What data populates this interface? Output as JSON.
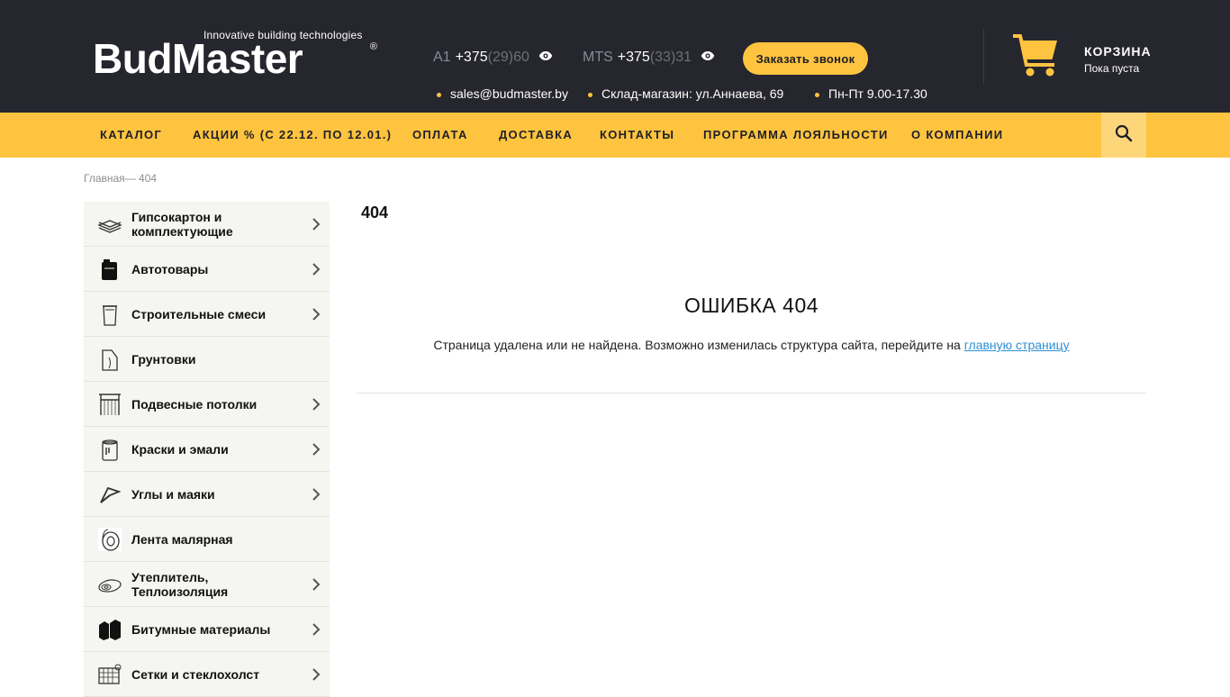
{
  "header": {
    "logo_tagline": "Innovative building technologies",
    "logo_text": "BudMaster",
    "logo_reg": "®",
    "phones": [
      {
        "operator": "A1",
        "main": "+375",
        "hidden": "(29)60"
      },
      {
        "operator": "MTS",
        "main": "+375",
        "hidden": "(33)31"
      }
    ],
    "callback_label": "Заказать звонок",
    "email": "sales@budmaster.by",
    "address": "Склад-магазин: ул.Аннаева, 69",
    "hours": "Пн-Пт 9.00-17.30",
    "cart_title": "КОРЗИНА",
    "cart_status": "Пока пуста"
  },
  "nav": {
    "items": [
      {
        "label": "КАТАЛОГ"
      },
      {
        "label": "АКЦИИ % (С 22.12. ПО 12.01.)"
      },
      {
        "label": "ОПЛАТА"
      },
      {
        "label": "ДОСТАВКА"
      },
      {
        "label": "КОНТАКТЫ"
      },
      {
        "label": "ПРОГРАММА ЛОЯЛЬНОСТИ"
      },
      {
        "label": "О КОМПАНИИ"
      }
    ],
    "search_icon": "search-icon"
  },
  "breadcrumb": {
    "home": "Главная",
    "separator": "— ",
    "current": "404"
  },
  "sidebar": {
    "categories": [
      {
        "label": "Гипсокартон и комплектующие",
        "icon": "drywall-icon",
        "has_children": true
      },
      {
        "label": "Автотовары",
        "icon": "canister-icon",
        "has_children": true
      },
      {
        "label": "Строительные смеси",
        "icon": "bucket-icon",
        "has_children": true
      },
      {
        "label": "Грунтовки",
        "icon": "primer-icon",
        "has_children": false
      },
      {
        "label": "Подвесные потолки",
        "icon": "ceiling-icon",
        "has_children": true
      },
      {
        "label": "Краски и эмали",
        "icon": "paint-can-icon",
        "has_children": true
      },
      {
        "label": "Углы и маяки",
        "icon": "corner-icon",
        "has_children": true
      },
      {
        "label": "Лента малярная",
        "icon": "tape-icon",
        "has_children": false
      },
      {
        "label": "Утеплитель, Теплоизоляция",
        "icon": "insulation-icon",
        "has_children": true
      },
      {
        "label": "Битумные материалы",
        "icon": "bitumen-icon",
        "has_children": true
      },
      {
        "label": "Сетки и стеклохолст",
        "icon": "mesh-icon",
        "has_children": true
      }
    ]
  },
  "main": {
    "page_title": "404",
    "error_title": "ОШИБКА 404",
    "error_text": "Страница удалена или не найдена. Возможно изменилась структура сайта, перейдите на ",
    "error_link": "главную страницу"
  },
  "colors": {
    "header_bg": "#26262e",
    "accent": "#fec43f",
    "sidebar_bg": "#f5f6f1",
    "link": "#2f8fd4"
  }
}
